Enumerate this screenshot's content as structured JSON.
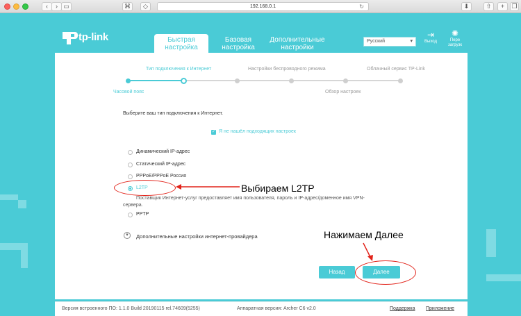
{
  "browser": {
    "url": "192.168.0.1"
  },
  "header": {
    "logo_text": "tp-link",
    "tabs": [
      {
        "label_line1": "Быстрая",
        "label_line2": "настройка",
        "active": true
      },
      {
        "label_line1": "Базовая",
        "label_line2": "настройка",
        "active": false
      },
      {
        "label_line1": "Дополнительные",
        "label_line2": "настройки",
        "active": false
      }
    ],
    "language": "Русский",
    "logout_label": "Выход",
    "reboot_label_line1": "Пере",
    "reboot_label_line2": "загрузк"
  },
  "stepper": {
    "top_labels": [
      "Тип подключения к Интернет",
      "Настройки беспроводного режима",
      "Облачный сервис TP-Link"
    ],
    "bottom_labels": [
      "Часовой пояс",
      "Обзор настроек"
    ]
  },
  "main": {
    "prompt": "Выберите ваш тип подключения к Интернет.",
    "checkbox_label": "Я не нашёл подходящих настроек",
    "options": [
      "Динамический IP-адрес",
      "Статический IP-адрес",
      "PPPoE/PPPoE Россия",
      "L2TP",
      "PPTP"
    ],
    "selected_option": "L2TP",
    "l2tp_note_line1": "Поставщик Интернет-услуг предоставляет имя пользователя, пароль и IP-адрес/доменное имя VPN-",
    "l2tp_note_line2": "сервера.",
    "advanced_label": "Дополнительные настройки интернет-провайдера",
    "back_button": "Назад",
    "next_button": "Далее"
  },
  "annotations": {
    "choose_l2tp": "Выбираем L2TP",
    "press_next": "Нажимаем Далее"
  },
  "footer": {
    "firmware": "Версия встроенного ПО: 1.1.0 Build 20190115 rel.74609(5255)",
    "hardware": "Аппаратная версия: Archer C6 v2.0",
    "support_link": "Поддержка",
    "app_link": "Приложение"
  },
  "colors": {
    "accent": "#4acbd6",
    "annotation_red": "#e2231a"
  }
}
